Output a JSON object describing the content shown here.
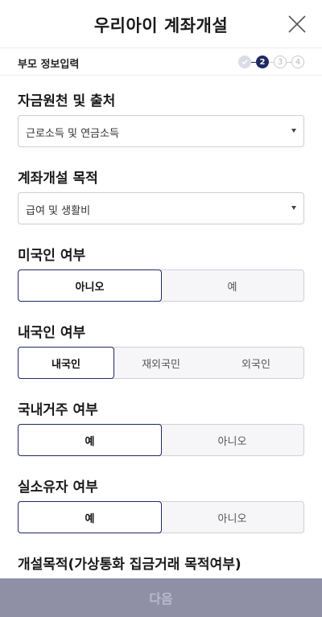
{
  "header": {
    "title": "우리아이 계좌개설",
    "close_icon": "close-icon"
  },
  "stepbar": {
    "label": "부모 정보입력",
    "steps": [
      {
        "label": "",
        "state": "done",
        "icon": "check-icon"
      },
      {
        "label": "2",
        "state": "active"
      },
      {
        "label": "3",
        "state": "todo"
      },
      {
        "label": "4",
        "state": "todo"
      }
    ]
  },
  "fund_source": {
    "title": "자금원천 및 출처",
    "value": "근로소득 및 연금소득"
  },
  "purpose": {
    "title": "계좌개설 목적",
    "value": "급여 및 생활비"
  },
  "us_person": {
    "title": "미국인 여부",
    "options": [
      "아니오",
      "예"
    ],
    "selected": 0
  },
  "nationality": {
    "title": "내국인 여부",
    "options": [
      "내국인",
      "재외국민",
      "외국인"
    ],
    "selected": 0
  },
  "residence": {
    "title": "국내거주 여부",
    "options": [
      "예",
      "아니오"
    ],
    "selected": 0
  },
  "beneficial_owner": {
    "title": "실소유자 여부",
    "options": [
      "예",
      "아니오"
    ],
    "selected": 0
  },
  "account_purpose_vasp": {
    "title": "개설목적(가상통화 집금거래 목적여부)"
  },
  "next_button": {
    "label": "다음"
  },
  "colors": {
    "accent": "#1f2a63",
    "button_disabled": "#8f90a6"
  }
}
